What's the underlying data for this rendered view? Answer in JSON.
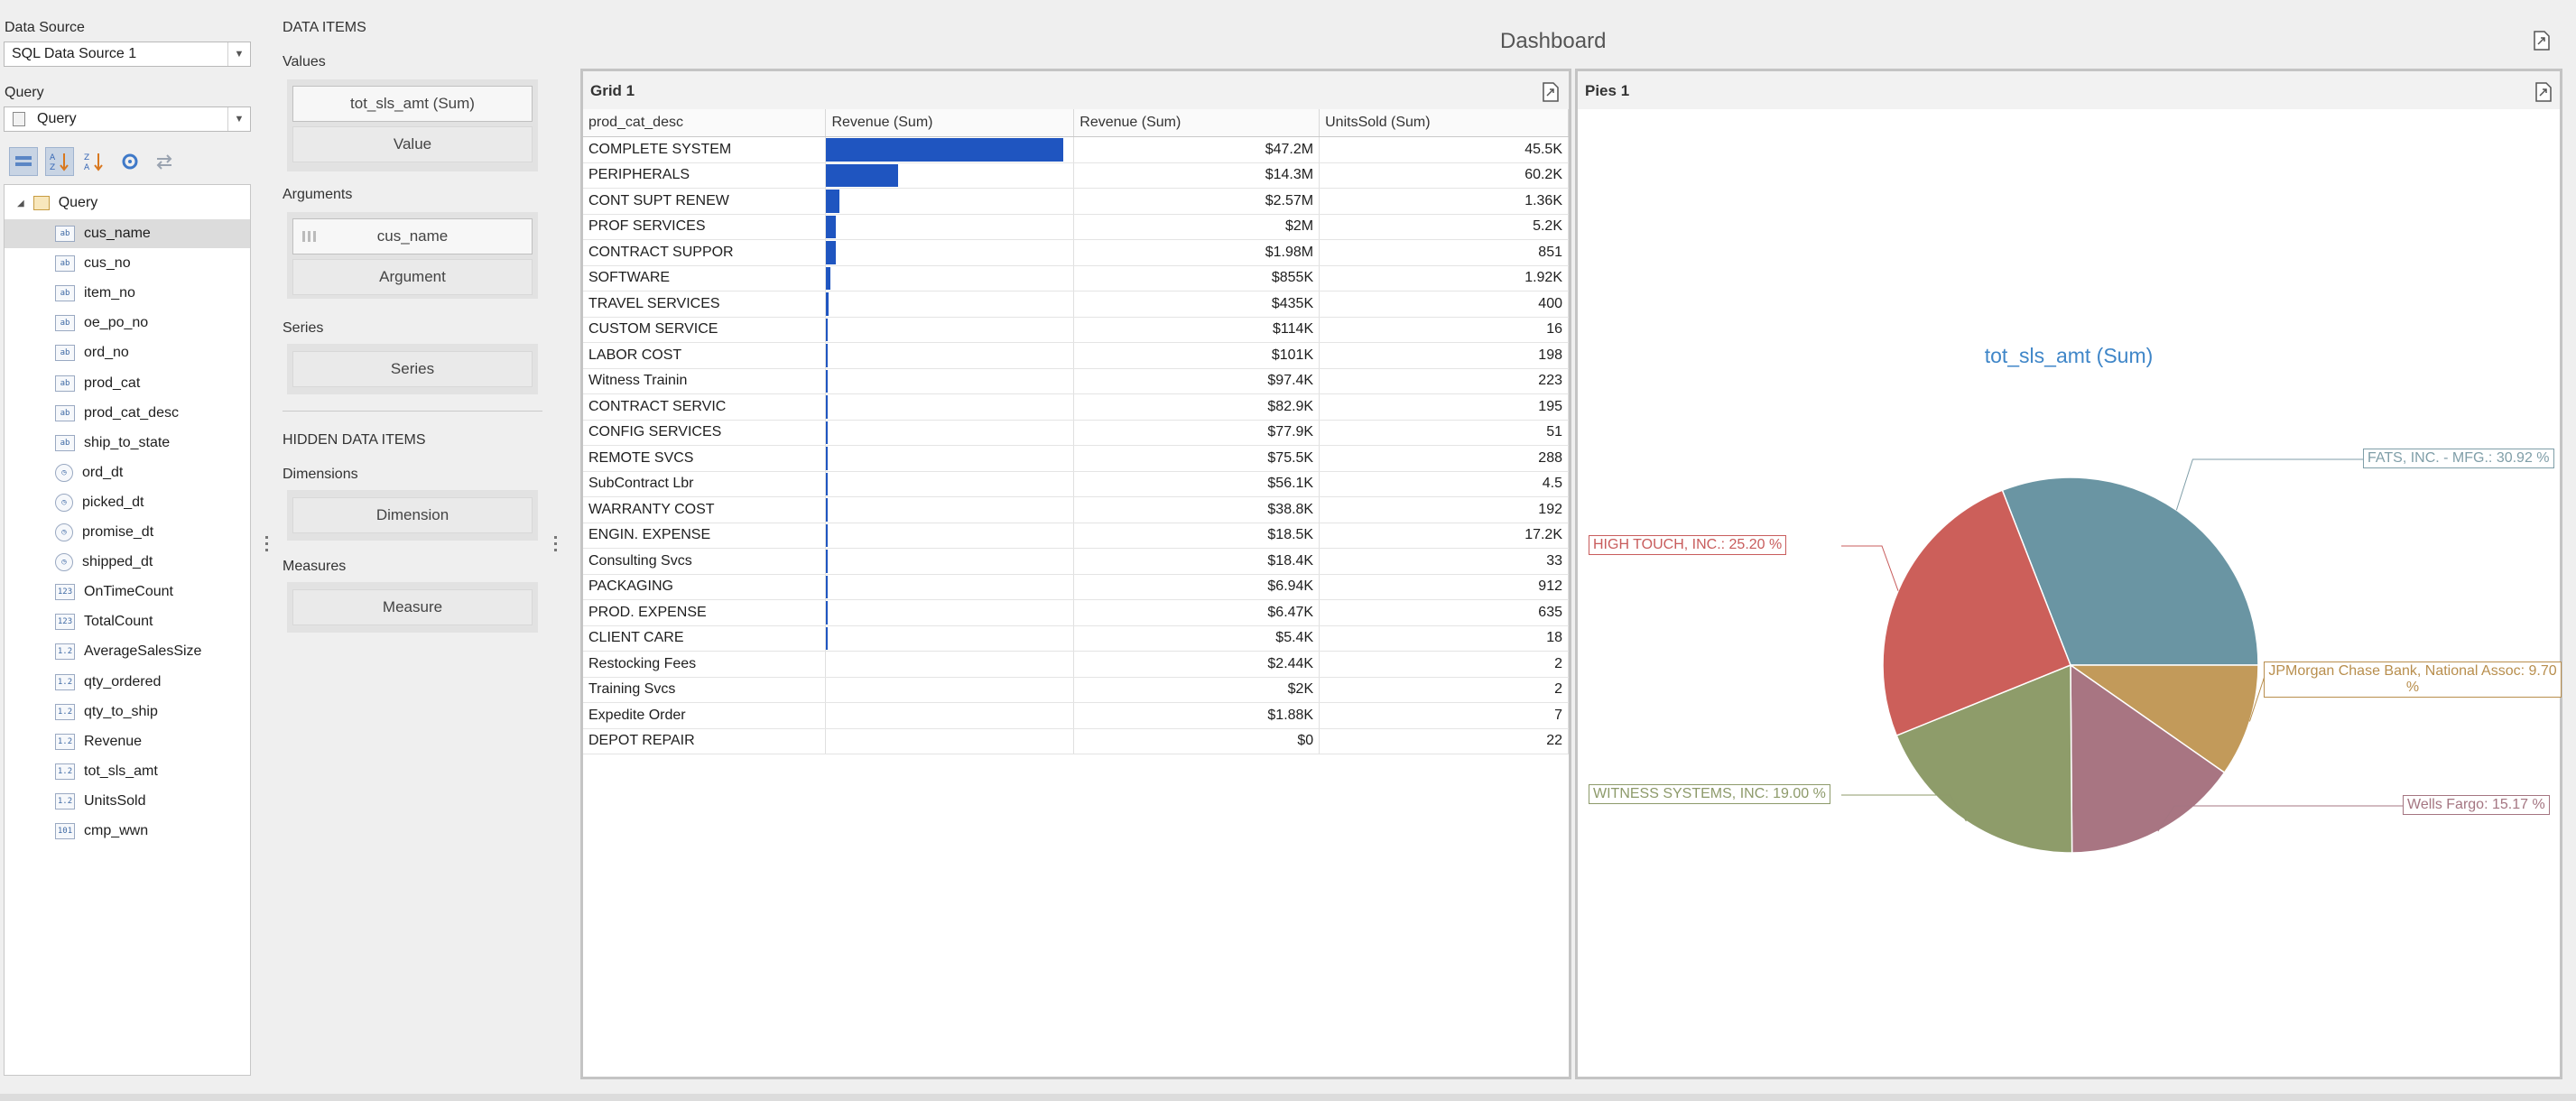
{
  "datasource": {
    "label": "Data Source",
    "value": "SQL Data Source 1"
  },
  "query": {
    "label": "Query",
    "value": "Query"
  },
  "toolbar": {
    "icons": [
      "group-by-type-icon",
      "sort-a-z-icon",
      "sort-z-a-icon",
      "refresh-icon",
      "swap-icon"
    ]
  },
  "fields": {
    "root": "Query",
    "items": [
      {
        "name": "cus_name",
        "type": "ab"
      },
      {
        "name": "cus_no",
        "type": "ab"
      },
      {
        "name": "item_no",
        "type": "ab"
      },
      {
        "name": "oe_po_no",
        "type": "ab"
      },
      {
        "name": "ord_no",
        "type": "ab"
      },
      {
        "name": "prod_cat",
        "type": "ab"
      },
      {
        "name": "prod_cat_desc",
        "type": "ab"
      },
      {
        "name": "ship_to_state",
        "type": "ab"
      },
      {
        "name": "ord_dt",
        "type": "date"
      },
      {
        "name": "picked_dt",
        "type": "date"
      },
      {
        "name": "promise_dt",
        "type": "date"
      },
      {
        "name": "shipped_dt",
        "type": "date"
      },
      {
        "name": "OnTimeCount",
        "type": "123"
      },
      {
        "name": "TotalCount",
        "type": "123"
      },
      {
        "name": "AverageSalesSize",
        "type": "1.2"
      },
      {
        "name": "qty_ordered",
        "type": "1.2"
      },
      {
        "name": "qty_to_ship",
        "type": "1.2"
      },
      {
        "name": "Revenue",
        "type": "1.2"
      },
      {
        "name": "tot_sls_amt",
        "type": "1.2"
      },
      {
        "name": "UnitsSold",
        "type": "1.2"
      },
      {
        "name": "cmp_wwn",
        "type": "101"
      }
    ]
  },
  "data_items": {
    "header": "DATA ITEMS",
    "values_label": "Values",
    "values_item": "tot_sls_amt (Sum)",
    "values_placeholder": "Value",
    "arguments_label": "Arguments",
    "arguments_item": "cus_name",
    "arguments_placeholder": "Argument",
    "series_label": "Series",
    "series_placeholder": "Series",
    "hidden_header": "HIDDEN DATA ITEMS",
    "dimensions_label": "Dimensions",
    "dimensions_placeholder": "Dimension",
    "measures_label": "Measures",
    "measures_placeholder": "Measure"
  },
  "dashboard": {
    "title": "Dashboard"
  },
  "grid": {
    "title": "Grid 1",
    "columns": [
      "prod_cat_desc",
      "Revenue (Sum)",
      "Revenue (Sum)",
      "UnitsSold (Sum)"
    ],
    "rows": [
      {
        "desc": "COMPLETE SYSTEM",
        "bar": 1.0,
        "rev": "$47.2M",
        "units": "45.5K"
      },
      {
        "desc": "PERIPHERALS",
        "bar": 0.303,
        "rev": "$14.3M",
        "units": "60.2K"
      },
      {
        "desc": "CONT SUPT RENEW",
        "bar": 0.054,
        "rev": "$2.57M",
        "units": "1.36K"
      },
      {
        "desc": "PROF SERVICES",
        "bar": 0.042,
        "rev": "$2M",
        "units": "5.2K"
      },
      {
        "desc": "CONTRACT SUPPOR",
        "bar": 0.042,
        "rev": "$1.98M",
        "units": "851"
      },
      {
        "desc": "SOFTWARE",
        "bar": 0.018,
        "rev": "$855K",
        "units": "1.92K"
      },
      {
        "desc": "TRAVEL SERVICES",
        "bar": 0.009,
        "rev": "$435K",
        "units": "400"
      },
      {
        "desc": "CUSTOM SERVICE",
        "bar": 0.0024,
        "rev": "$114K",
        "units": "16"
      },
      {
        "desc": "LABOR COST",
        "bar": 0.0021,
        "rev": "$101K",
        "units": "198"
      },
      {
        "desc": "Witness Trainin",
        "bar": 0.0021,
        "rev": "$97.4K",
        "units": "223"
      },
      {
        "desc": "CONTRACT SERVIC",
        "bar": 0.0018,
        "rev": "$82.9K",
        "units": "195"
      },
      {
        "desc": "CONFIG SERVICES",
        "bar": 0.0017,
        "rev": "$77.9K",
        "units": "51"
      },
      {
        "desc": "REMOTE SVCS",
        "bar": 0.0016,
        "rev": "$75.5K",
        "units": "288"
      },
      {
        "desc": "SubContract Lbr",
        "bar": 0.0012,
        "rev": "$56.1K",
        "units": "4.5"
      },
      {
        "desc": "WARRANTY COST",
        "bar": 0.0008,
        "rev": "$38.8K",
        "units": "192"
      },
      {
        "desc": "ENGIN. EXPENSE",
        "bar": 0.0004,
        "rev": "$18.5K",
        "units": "17.2K"
      },
      {
        "desc": "Consulting Svcs",
        "bar": 0.0004,
        "rev": "$18.4K",
        "units": "33"
      },
      {
        "desc": "PACKAGING",
        "bar": 0.0001,
        "rev": "$6.94K",
        "units": "912"
      },
      {
        "desc": "PROD. EXPENSE",
        "bar": 0.0001,
        "rev": "$6.47K",
        "units": "635"
      },
      {
        "desc": "CLIENT CARE",
        "bar": 0.0001,
        "rev": "$5.4K",
        "units": "18"
      },
      {
        "desc": "Restocking Fees",
        "bar": 0.0,
        "rev": "$2.44K",
        "units": "2"
      },
      {
        "desc": "Training Svcs",
        "bar": 0.0,
        "rev": "$2K",
        "units": "2"
      },
      {
        "desc": "Expedite Order",
        "bar": 0.0,
        "rev": "$1.88K",
        "units": "7"
      },
      {
        "desc": "DEPOT REPAIR",
        "bar": 0.0,
        "rev": "$0",
        "units": "22"
      }
    ]
  },
  "pies": {
    "title": "Pies 1"
  },
  "chart_data": {
    "type": "pie",
    "title": "tot_sls_amt (Sum)",
    "slices": [
      {
        "label": "FATS, INC. - MFG.: 30.92 %",
        "value": 30.92,
        "color": "#6a95a3",
        "stroke": "#7f9ea8"
      },
      {
        "label": "JPMorgan Chase Bank, National Assoc: 9.70 %",
        "value": 9.7,
        "color": "#c29a5a",
        "stroke": "#b88e4d"
      },
      {
        "label": "Wells Fargo: 15.17 %",
        "value": 15.17,
        "color": "#a87582",
        "stroke": "#a47581"
      },
      {
        "label": "WITNESS SYSTEMS, INC: 19.00 %",
        "value": 19.0,
        "color": "#8e9c6a",
        "stroke": "#8d9a6a"
      },
      {
        "label": "HIGH TOUCH, INC.: 25.20 %",
        "value": 25.2,
        "color": "#cc5f5a",
        "stroke": "#c85c5c"
      }
    ]
  }
}
